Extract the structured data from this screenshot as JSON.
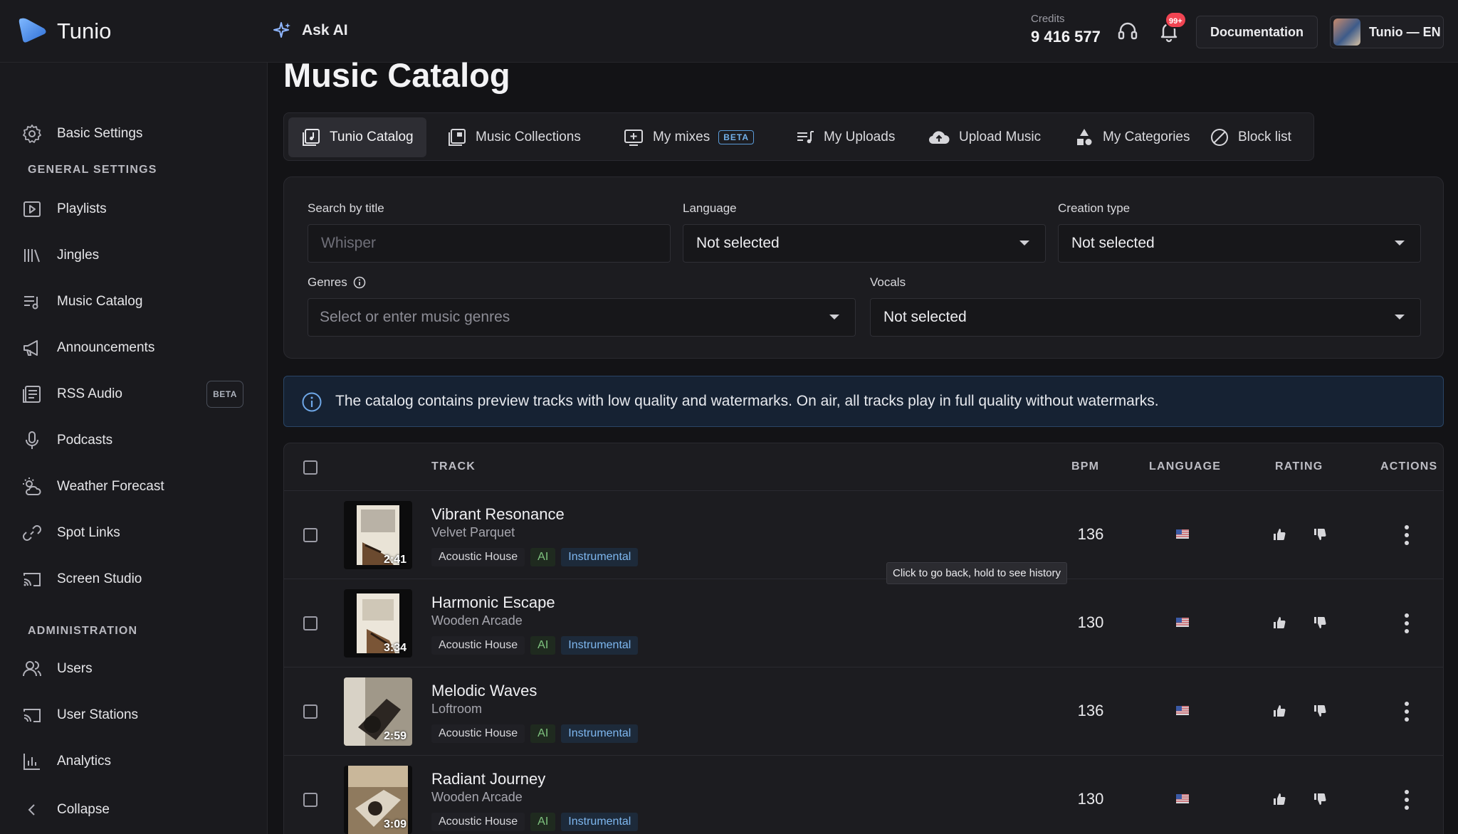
{
  "header": {
    "brand": "Tunio",
    "ask_ai": "Ask AI",
    "credits_label": "Credits",
    "credits_value": "9 416 577",
    "notifications_badge": "99+",
    "documentation": "Documentation",
    "account": "Tunio — EN"
  },
  "sidebar": {
    "basic_settings": "Basic Settings",
    "general_heading": "GENERAL SETTINGS",
    "items": [
      {
        "label": "Playlists",
        "icon": "playlist-icon"
      },
      {
        "label": "Jingles",
        "icon": "library-icon"
      },
      {
        "label": "Music Catalog",
        "icon": "music-list-icon"
      },
      {
        "label": "Announcements",
        "icon": "megaphone-icon"
      },
      {
        "label": "RSS Audio",
        "icon": "rss-icon",
        "badge": "BETA"
      },
      {
        "label": "Podcasts",
        "icon": "microphone-icon"
      },
      {
        "label": "Weather Forecast",
        "icon": "weather-icon"
      },
      {
        "label": "Spot Links",
        "icon": "link-icon"
      },
      {
        "label": "Screen Studio",
        "icon": "cast-icon"
      }
    ],
    "admin_heading": "ADMINISTRATION",
    "admin_items": [
      {
        "label": "Users",
        "icon": "users-icon"
      },
      {
        "label": "User Stations",
        "icon": "stations-icon"
      },
      {
        "label": "Analytics",
        "icon": "analytics-icon"
      }
    ],
    "collapse": "Collapse"
  },
  "main": {
    "title": "Music Catalog",
    "tabs": [
      {
        "label": "Tunio Catalog",
        "active": true
      },
      {
        "label": "Music Collections"
      },
      {
        "label": "My mixes",
        "badge": "BETA"
      },
      {
        "label": "My Uploads"
      },
      {
        "label": "Upload Music"
      },
      {
        "label": "My Categories"
      },
      {
        "label": "Block list"
      }
    ],
    "filters": {
      "search_label": "Search by title",
      "search_placeholder": "Whisper",
      "language_label": "Language",
      "language_value": "Not selected",
      "creation_label": "Creation type",
      "creation_value": "Not selected",
      "genres_label": "Genres",
      "genres_placeholder": "Select or enter music genres",
      "vocals_label": "Vocals",
      "vocals_value": "Not selected"
    },
    "banner": "The catalog contains preview tracks with low quality and watermarks. On air, all tracks play in full quality without watermarks.",
    "table": {
      "headers": {
        "track": "TRACK",
        "bpm": "BPM",
        "language": "LANGUAGE",
        "rating": "RATING",
        "actions": "ACTIONS"
      },
      "rows": [
        {
          "title": "Vibrant Resonance",
          "artist": "Velvet Parquet",
          "duration": "2:41",
          "genre": "Acoustic House",
          "ai": "AI",
          "type": "Instrumental",
          "bpm": "136"
        },
        {
          "title": "Harmonic Escape",
          "artist": "Wooden Arcade",
          "duration": "3:34",
          "genre": "Acoustic House",
          "ai": "AI",
          "type": "Instrumental",
          "bpm": "130"
        },
        {
          "title": "Melodic Waves",
          "artist": "Loftroom",
          "duration": "2:59",
          "genre": "Acoustic House",
          "ai": "AI",
          "type": "Instrumental",
          "bpm": "136"
        },
        {
          "title": "Radiant Journey",
          "artist": "Wooden Arcade",
          "duration": "3:09",
          "genre": "Acoustic House",
          "ai": "AI",
          "type": "Instrumental",
          "bpm": "130"
        }
      ]
    },
    "tooltip": "Click to go back, hold to see history"
  },
  "colors": {
    "accent": "#4a90e2",
    "badge": "#f04452",
    "ai_tag": "#7fc37f",
    "instrumental_tag": "#7eb7ef"
  }
}
